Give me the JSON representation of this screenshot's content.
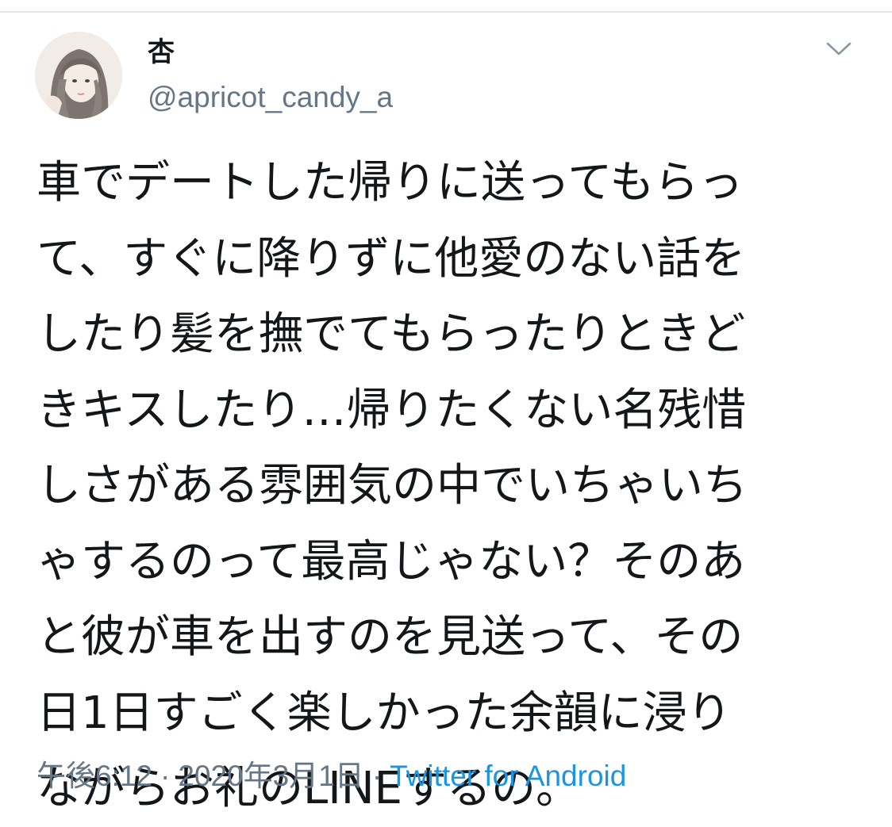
{
  "tweet": {
    "author": {
      "display_name": "杏",
      "handle": "@apricot_candy_a",
      "avatar_icon": "user-avatar-illustration"
    },
    "text_lines": [
      "車でデートした帰りに送ってもらっ",
      "て、すぐに降りずに他愛のない話を",
      "したり髪を撫でてもらったりときど",
      "きキスしたり…帰りたくない名残惜",
      "しさがある雰囲気の中でいちゃいち",
      "ゃするのって最高じゃない？そのあ",
      "と彼が車を出すのを見送って、その",
      "日1日すごく楽しかった余韻に浸り",
      "ながらお礼のLINEするの。"
    ],
    "time": "午後6:12",
    "separator": "·",
    "date": "2020年3月1日",
    "source": "Twitter for Android",
    "more_icon": "chevron-down-icon"
  },
  "colors": {
    "text": "#14171a",
    "secondary": "#657786",
    "link": "#1b95e0",
    "divider": "#e1e8ed"
  }
}
